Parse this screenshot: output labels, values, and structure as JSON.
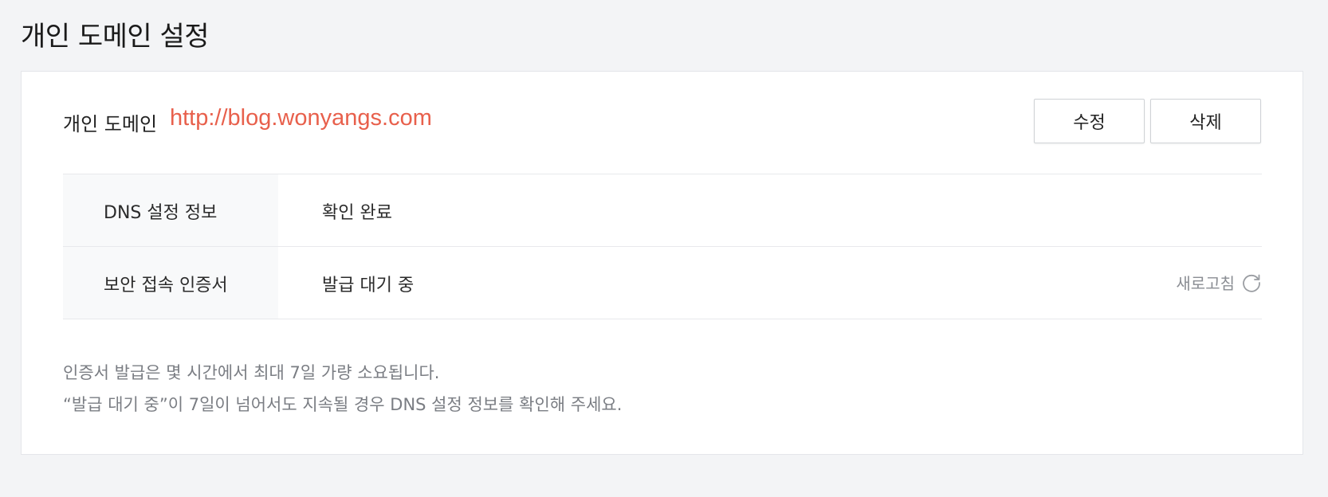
{
  "page": {
    "title": "개인 도메인 설정"
  },
  "domain": {
    "label": "개인 도메인",
    "url": "http://blog.wonyangs.com",
    "url_color": "#e8604c"
  },
  "actions": {
    "edit_label": "수정",
    "delete_label": "삭제"
  },
  "info_rows": [
    {
      "key": "DNS 설정 정보",
      "value": "확인 완료"
    },
    {
      "key": "보안 접속 인증서",
      "value": "발급 대기 중"
    }
  ],
  "refresh": {
    "label": "새로고침",
    "icon": "refresh-icon"
  },
  "notes": [
    "인증서 발급은 몇 시간에서 최대 7일 가량 소요됩니다.",
    "“발급 대기 중”이 7일이 넘어서도 지속될 경우 DNS 설정 정보를 확인해 주세요."
  ]
}
